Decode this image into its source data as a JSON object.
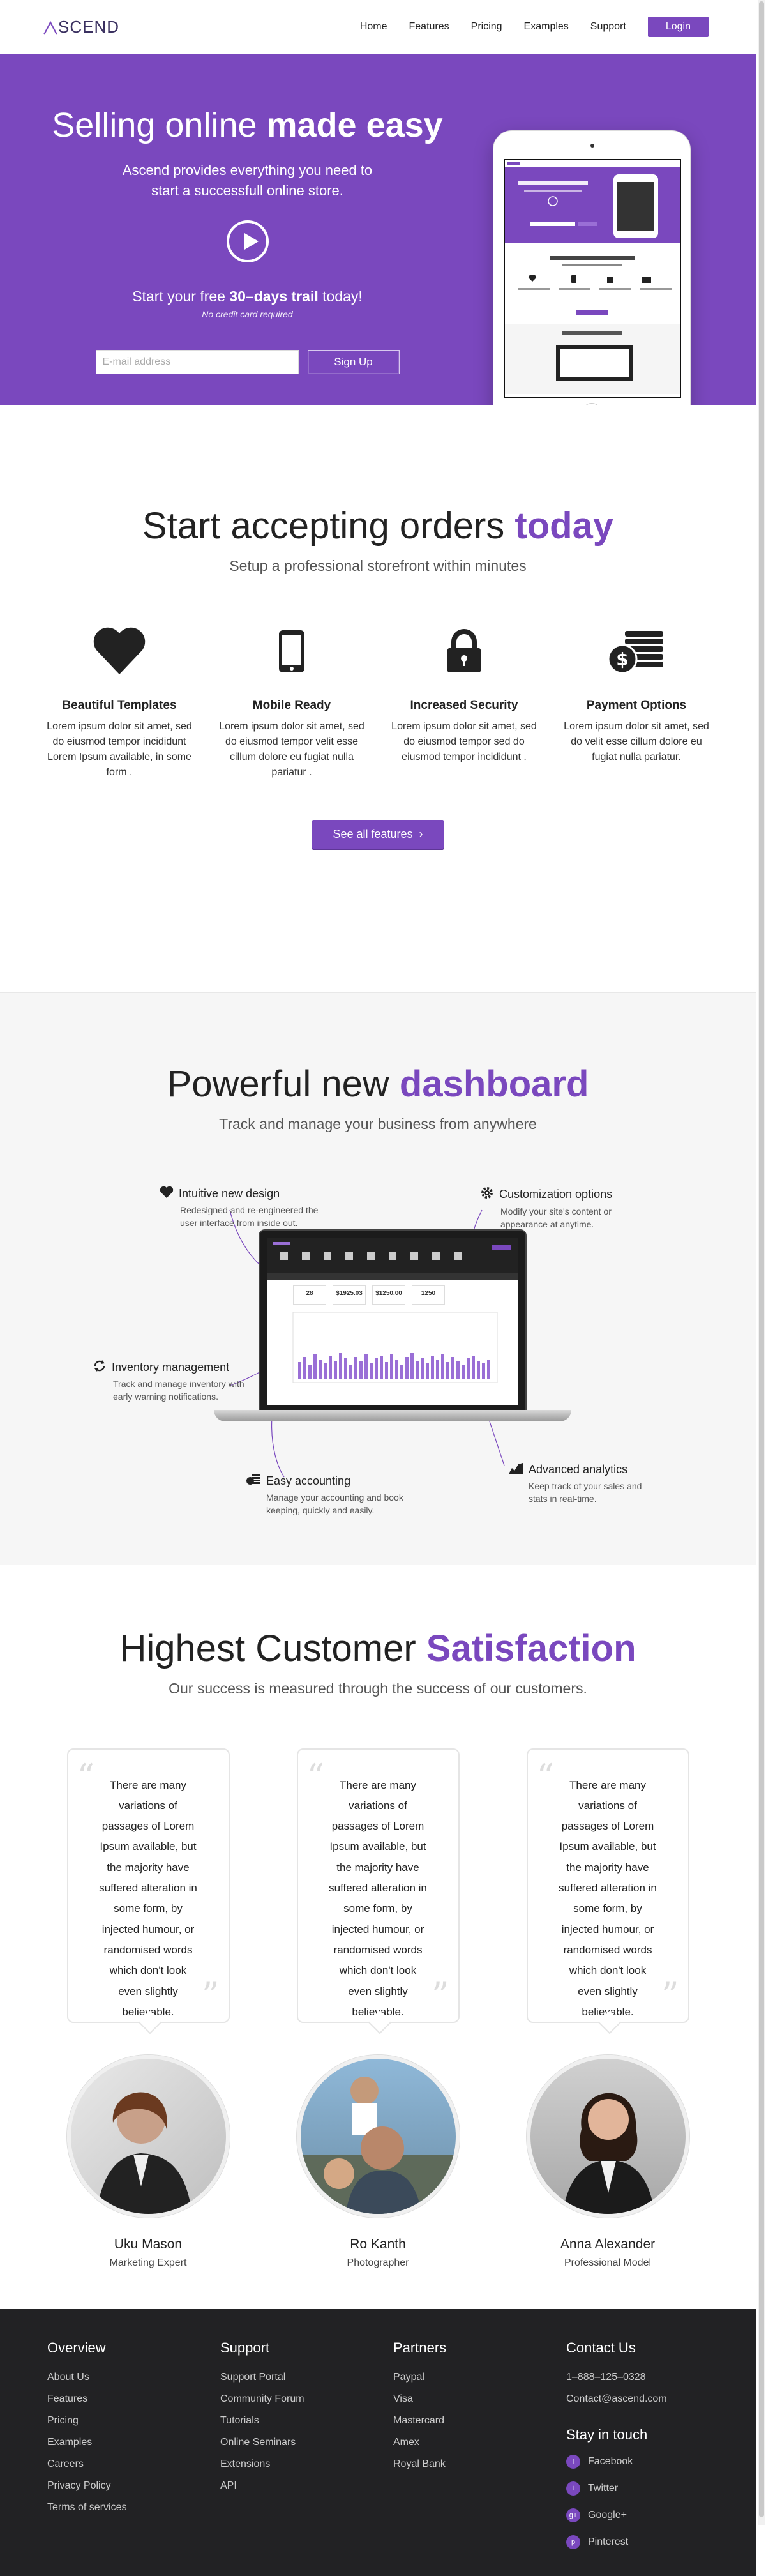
{
  "header": {
    "logo_text": "SCEND",
    "nav": [
      "Home",
      "Features",
      "Pricing",
      "Examples",
      "Support"
    ],
    "login_label": "Login"
  },
  "hero": {
    "title_light": "Selling online ",
    "title_bold": "made easy",
    "subtitle_line1": "Ascend provides everything you need to",
    "subtitle_line2": "start a successfull online store.",
    "trial_prefix": "Start your free ",
    "trial_bold": "30–days trail",
    "trial_suffix": " today!",
    "no_card": "No credit card required",
    "email_placeholder": "E-mail address",
    "signup_label": "Sign Up"
  },
  "orders": {
    "title_light": "Start accepting orders ",
    "title_bold": "today",
    "subtitle": "Setup a professional storefront within minutes",
    "features": [
      {
        "icon": "heart-icon",
        "title": "Beautiful Templates",
        "text": "Lorem ipsum dolor sit amet, sed do eiusmod tempor incididunt Lorem Ipsum available, in some form ."
      },
      {
        "icon": "mobile-icon",
        "title": "Mobile Ready",
        "text": "Lorem ipsum dolor sit amet, sed do eiusmod tempor velit esse cillum dolore eu fugiat nulla pariatur ."
      },
      {
        "icon": "lock-icon",
        "title": "Increased Security",
        "text": "Lorem ipsum dolor sit amet, sed do eiusmod tempor sed do eiusmod tempor incididunt ."
      },
      {
        "icon": "coins-icon",
        "title": "Payment Options",
        "text": "Lorem ipsum dolor sit amet, sed do velit esse cillum dolore eu fugiat nulla pariatur."
      }
    ],
    "button_label": "See all features"
  },
  "dashboard": {
    "title_light": "Powerful new ",
    "title_bold": "dashboard",
    "subtitle": "Track and manage your business from anywhere",
    "callouts": [
      {
        "title": "Intuitive new design",
        "text": "Redesigned and re-engineered the user interface from inside out."
      },
      {
        "title": "Customization options",
        "text": "Modify your site's content or appearance at anytime."
      },
      {
        "title": "Inventory management",
        "text": "Track and manage inventory with early warning notifications."
      },
      {
        "title": "Easy accounting",
        "text": "Manage your accounting and book keeping, quickly and easily."
      },
      {
        "title": "Advanced analytics",
        "text": "Keep track of your sales and stats in real-time."
      }
    ],
    "stats": [
      "28",
      "$1925.03",
      "$1250.00",
      "1250"
    ]
  },
  "testimonials": {
    "title_light": "Highest Customer ",
    "title_bold": "Satisfaction",
    "subtitle": "Our success is measured through the success of our customers.",
    "quote": "There are many variations of passages of Lorem Ipsum available, but the majority have suffered alteration in some form, by injected humour, or randomised words which don't look even slightly believable.",
    "people": [
      {
        "name": "Uku Mason",
        "role": "Marketing Expert"
      },
      {
        "name": "Ro Kanth",
        "role": "Photographer"
      },
      {
        "name": "Anna Alexander",
        "role": "Professional Model"
      }
    ]
  },
  "footer": {
    "overview": {
      "title": "Overview",
      "links": [
        "About Us",
        "Features",
        "Pricing",
        "Examples",
        "Careers",
        "Privacy Policy",
        "Terms of services"
      ]
    },
    "support": {
      "title": "Support",
      "links": [
        "Support Portal",
        "Community Forum",
        "Tutorials",
        "Online Seminars",
        "Extensions",
        "API"
      ]
    },
    "partners": {
      "title": "Partners",
      "links": [
        "Paypal",
        "Visa",
        "Mastercard",
        "Amex",
        "Royal Bank"
      ]
    },
    "contact": {
      "title": "Contact Us",
      "phone": "1–888–125–0328",
      "email": "Contact@ascend.com",
      "stay_title": "Stay in touch",
      "social": [
        "Facebook",
        "Twitter",
        "Google+",
        "Pinterest"
      ]
    }
  },
  "colors": {
    "accent": "#7a48be",
    "footer_bg": "#222224"
  }
}
